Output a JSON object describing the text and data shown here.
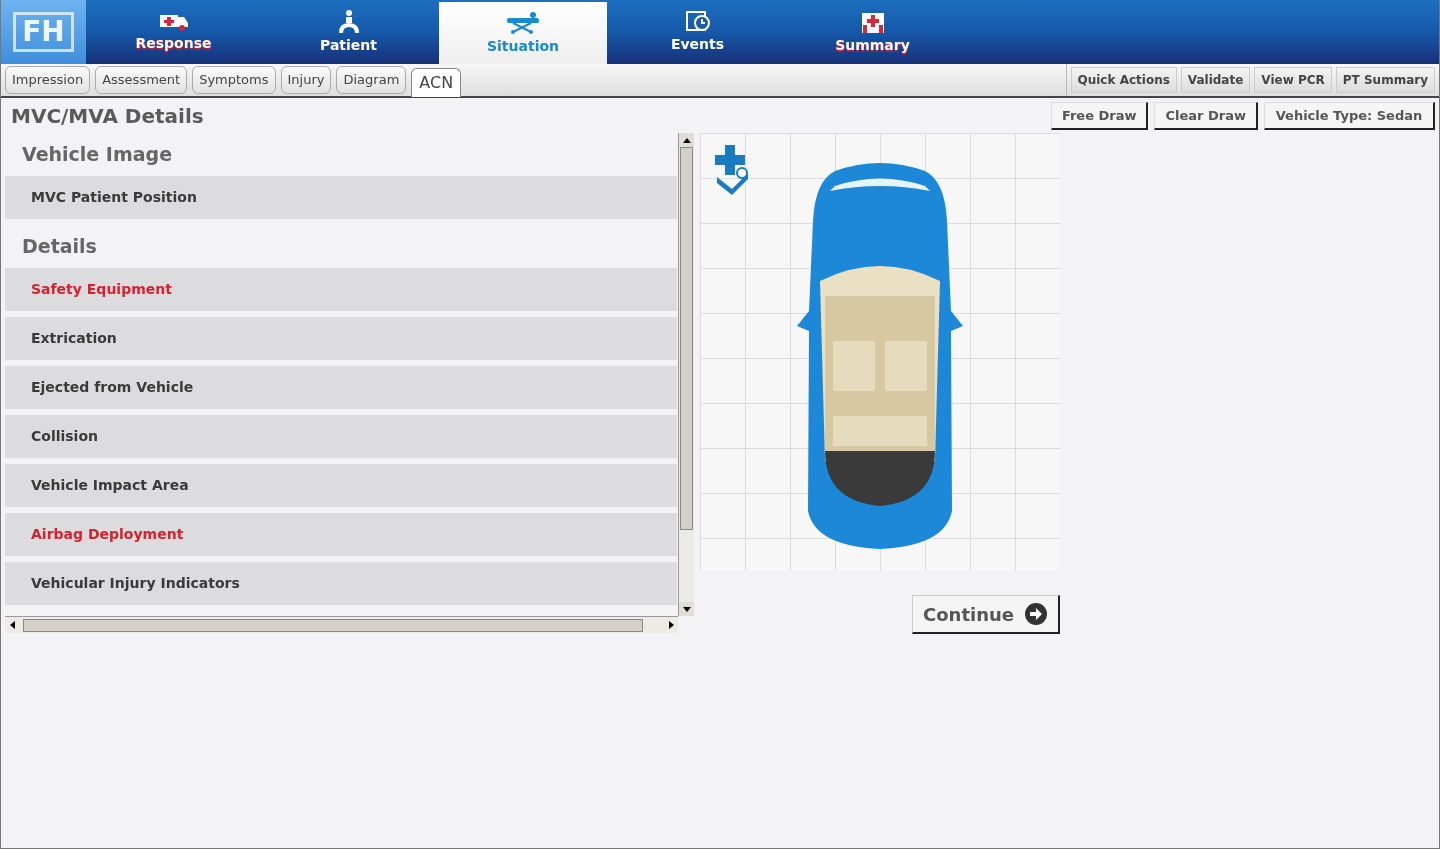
{
  "app": {
    "logo": "FH"
  },
  "main_tabs": [
    {
      "label": "Response",
      "selected": false
    },
    {
      "label": "Patient",
      "selected": false
    },
    {
      "label": "Situation",
      "selected": true
    },
    {
      "label": "Events",
      "selected": false
    },
    {
      "label": "Summary",
      "selected": false
    }
  ],
  "sub_tabs": [
    {
      "label": "Impression",
      "selected": false
    },
    {
      "label": "Assessment",
      "selected": false
    },
    {
      "label": "Symptoms",
      "selected": false
    },
    {
      "label": "Injury",
      "selected": false
    },
    {
      "label": "Diagram",
      "selected": false
    },
    {
      "label": "ACN",
      "selected": true
    }
  ],
  "actions": [
    "Quick Actions",
    "Validate",
    "View PCR",
    "PT Summary"
  ],
  "page_title": "MVC/MVA Details",
  "sections": [
    {
      "title": "Vehicle Image",
      "items": [
        {
          "label": "MVC Patient Position",
          "alert": false
        }
      ]
    },
    {
      "title": "Details",
      "items": [
        {
          "label": "Safety Equipment",
          "alert": true
        },
        {
          "label": "Extrication",
          "alert": false
        },
        {
          "label": "Ejected from Vehicle",
          "alert": false
        },
        {
          "label": "Collision",
          "alert": false
        },
        {
          "label": "Vehicle Impact Area",
          "alert": false
        },
        {
          "label": "Airbag Deployment",
          "alert": true
        },
        {
          "label": "Vehicular Injury Indicators",
          "alert": false
        }
      ]
    }
  ],
  "diagram_tools": [
    "Free Draw",
    "Clear Draw",
    "Vehicle Type: Sedan"
  ],
  "continue_button": "Continue"
}
